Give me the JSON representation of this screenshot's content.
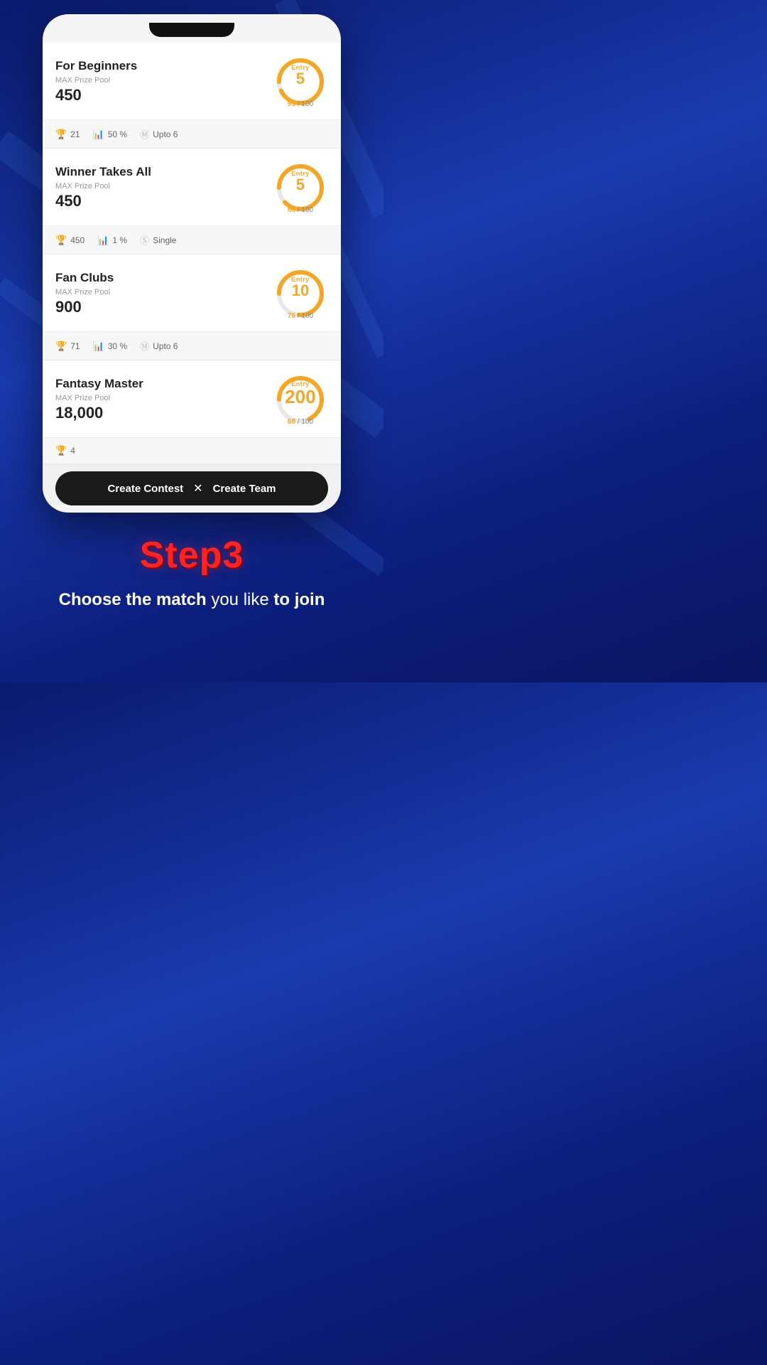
{
  "contests": [
    {
      "id": "for-beginners",
      "title": "For Beginners",
      "max_prize_label": "MAX Prize Pool",
      "prize": "450",
      "entry": "5",
      "filled": 93,
      "total": 100,
      "stats": [
        {
          "icon": "trophy",
          "value": "21"
        },
        {
          "icon": "bar-chart",
          "value": "50 %"
        },
        {
          "icon": "m-badge",
          "value": "Upto 6"
        }
      ]
    },
    {
      "id": "winner-takes-all",
      "title": "Winner Takes All",
      "max_prize_label": "MAX Prize Pool",
      "prize": "450",
      "entry": "5",
      "filled": 88,
      "total": 100,
      "stats": [
        {
          "icon": "trophy",
          "value": "450"
        },
        {
          "icon": "bar-chart",
          "value": "1 %"
        },
        {
          "icon": "s-badge",
          "value": "Single"
        }
      ]
    },
    {
      "id": "fan-clubs",
      "title": "Fan Clubs",
      "max_prize_label": "MAX Prize Pool",
      "prize": "900",
      "entry": "10",
      "filled": 76,
      "total": 100,
      "stats": [
        {
          "icon": "trophy",
          "value": "71"
        },
        {
          "icon": "bar-chart",
          "value": "30 %"
        },
        {
          "icon": "m-badge",
          "value": "Upto 6"
        }
      ]
    },
    {
      "id": "fantasy-master",
      "title": "Fantasy Master",
      "max_prize_label": "MAX Prize Pool",
      "prize": "18,000",
      "entry": "200",
      "filled": 68,
      "total": 100,
      "stats": [
        {
          "icon": "trophy",
          "value": "4"
        }
      ]
    }
  ],
  "bottom_bar": {
    "create_contest": "Create Contest",
    "divider": "✕",
    "create_team": "Create Team"
  },
  "step": {
    "title": "Step3",
    "subtitle_bold1": "Choose the match",
    "subtitle_normal": " you like ",
    "subtitle_bold2": "to join"
  }
}
